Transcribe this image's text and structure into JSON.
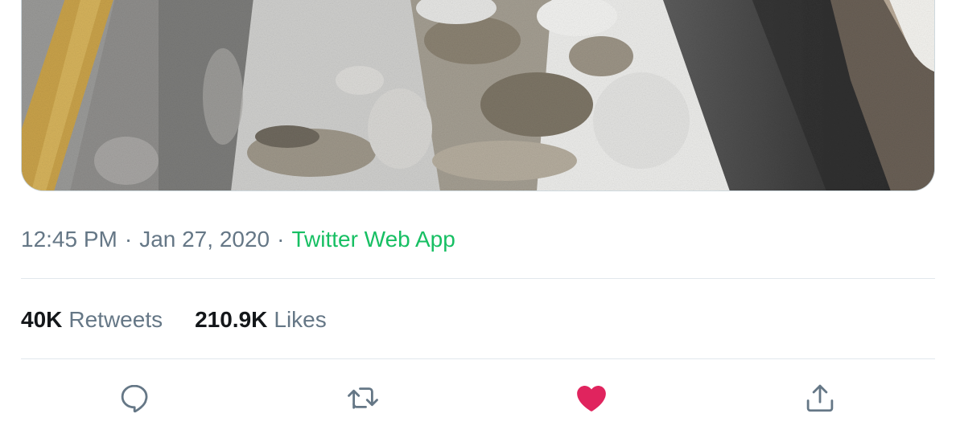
{
  "tweet": {
    "time": "12:45 PM",
    "date": "Jan 27, 2020",
    "separator": "·",
    "source": "Twitter Web App"
  },
  "stats": {
    "retweets_count": "40K",
    "retweets_label": "Retweets",
    "likes_count": "210.9K",
    "likes_label": "Likes"
  },
  "actions": {
    "reply_icon": "reply-icon",
    "retweet_icon": "retweet-icon",
    "like_icon": "heart-filled-icon",
    "share_icon": "share-icon",
    "like_active": true
  },
  "colors": {
    "source_link": "#17bf63",
    "muted_text": "#657786",
    "strong_text": "#14171a",
    "like_active": "#e0245e",
    "action_icon": "#657786"
  }
}
